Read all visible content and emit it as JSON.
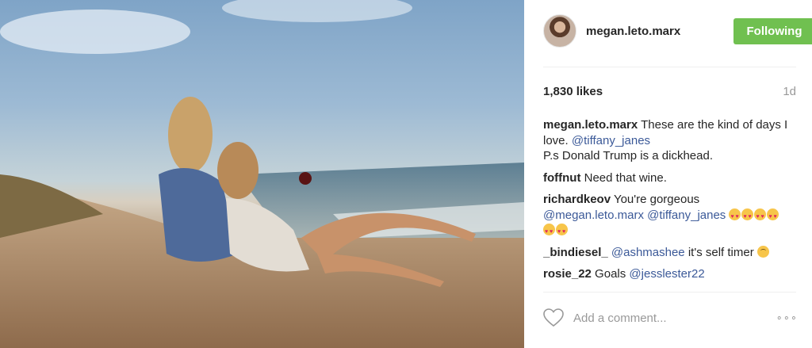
{
  "post": {
    "image_alt": "",
    "image_icon": "beach-photo"
  },
  "header": {
    "username": "megan.leto.marx",
    "follow_label": "Following"
  },
  "stats": {
    "likes": "1,830 likes",
    "age": "1d"
  },
  "comments": [
    {
      "user": "megan.leto.marx",
      "parts": [
        " These are the kind of days I love. ",
        "@tiffany_janes"
      ],
      "line2": "P.s Donald Trump is a dickhead."
    },
    {
      "user": "foffnut",
      "text": " Need that wine."
    },
    {
      "user": "richardkeov",
      "text": " You're gorgeous",
      "mentions": [
        "@megan.leto.marx",
        "@tiffany_janes"
      ]
    },
    {
      "user": "_bindiesel_",
      "mention": "@ashmashee",
      "text": " it's self timer"
    },
    {
      "user": "rosie_22",
      "text": " Goals ",
      "mention": "@jesslester22"
    }
  ],
  "footer": {
    "add_comment_placeholder": "Add a comment...",
    "more_label": "∘∘∘"
  },
  "colors": {
    "follow_button": "#70c050",
    "mention": "#3b5998"
  }
}
